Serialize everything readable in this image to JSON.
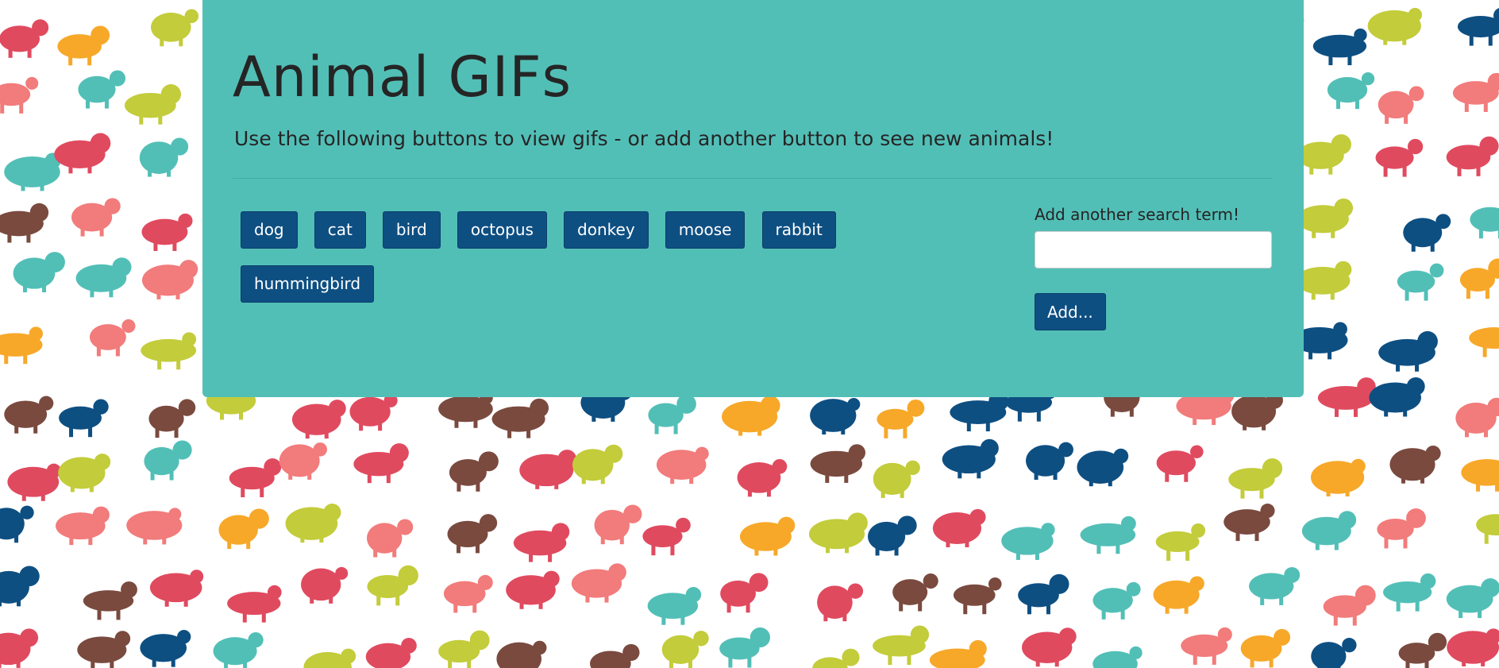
{
  "header": {
    "title": "Animal GIFs",
    "subtitle": "Use the following buttons to view gifs - or add another button to see new animals!"
  },
  "animal_buttons": [
    {
      "label": "dog"
    },
    {
      "label": "cat"
    },
    {
      "label": "bird"
    },
    {
      "label": "octopus"
    },
    {
      "label": "donkey"
    },
    {
      "label": "moose"
    },
    {
      "label": "rabbit"
    },
    {
      "label": "hummingbird"
    }
  ],
  "form": {
    "label": "Add another search term!",
    "input_value": "",
    "submit_label": "Add..."
  },
  "colors": {
    "panel": "#52bfb7",
    "button": "#0e4f82",
    "text": "#252525"
  },
  "background": {
    "pattern_icons": [
      "whale-icon",
      "moose-icon",
      "swan-icon",
      "camel-icon",
      "elephant-icon",
      "giraffe-icon",
      "rhino-icon",
      "dolphin-icon",
      "kangaroo-icon",
      "deer-icon",
      "crab-icon",
      "owl-icon",
      "octopus-icon",
      "bat-icon",
      "snake-icon"
    ]
  }
}
